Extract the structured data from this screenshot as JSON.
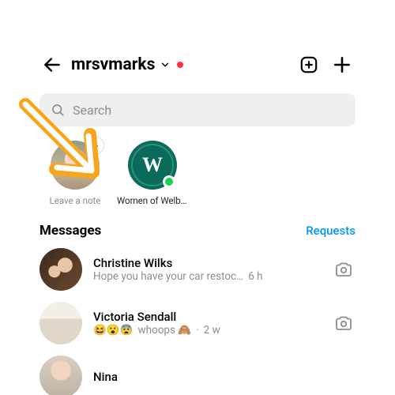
{
  "header": {
    "username": "mrsvmarks",
    "has_unread_dot": true
  },
  "search": {
    "placeholder": "Search",
    "value": ""
  },
  "notes": {
    "leave_label": "Leave a note",
    "items": [
      {
        "label": "Women of Welbeck",
        "logo_letter": "W",
        "active": true
      }
    ]
  },
  "section": {
    "heading": "Messages",
    "requests_label": "Requests"
  },
  "messages": [
    {
      "name": "Christine Wilks",
      "preview": "Hope you have your car restoc…",
      "time": "6 h",
      "emoji_prefix": ""
    },
    {
      "name": "Victoria Sendall",
      "preview": "whoops 🙈",
      "time": "2 w",
      "emoji_prefix": "😆😮😨"
    },
    {
      "name": "Nina",
      "preview": "",
      "time": "",
      "emoji_prefix": ""
    }
  ],
  "icons": {
    "back": "back-arrow",
    "chevron_down": "chevron-down",
    "new_message": "new-message",
    "compose": "compose-plus",
    "search": "search",
    "camera": "camera",
    "plus_badge": "+",
    "separator": "·"
  },
  "annotation": {
    "type": "arrow",
    "color": "#f7a51b",
    "points_to": "leave-a-note"
  }
}
